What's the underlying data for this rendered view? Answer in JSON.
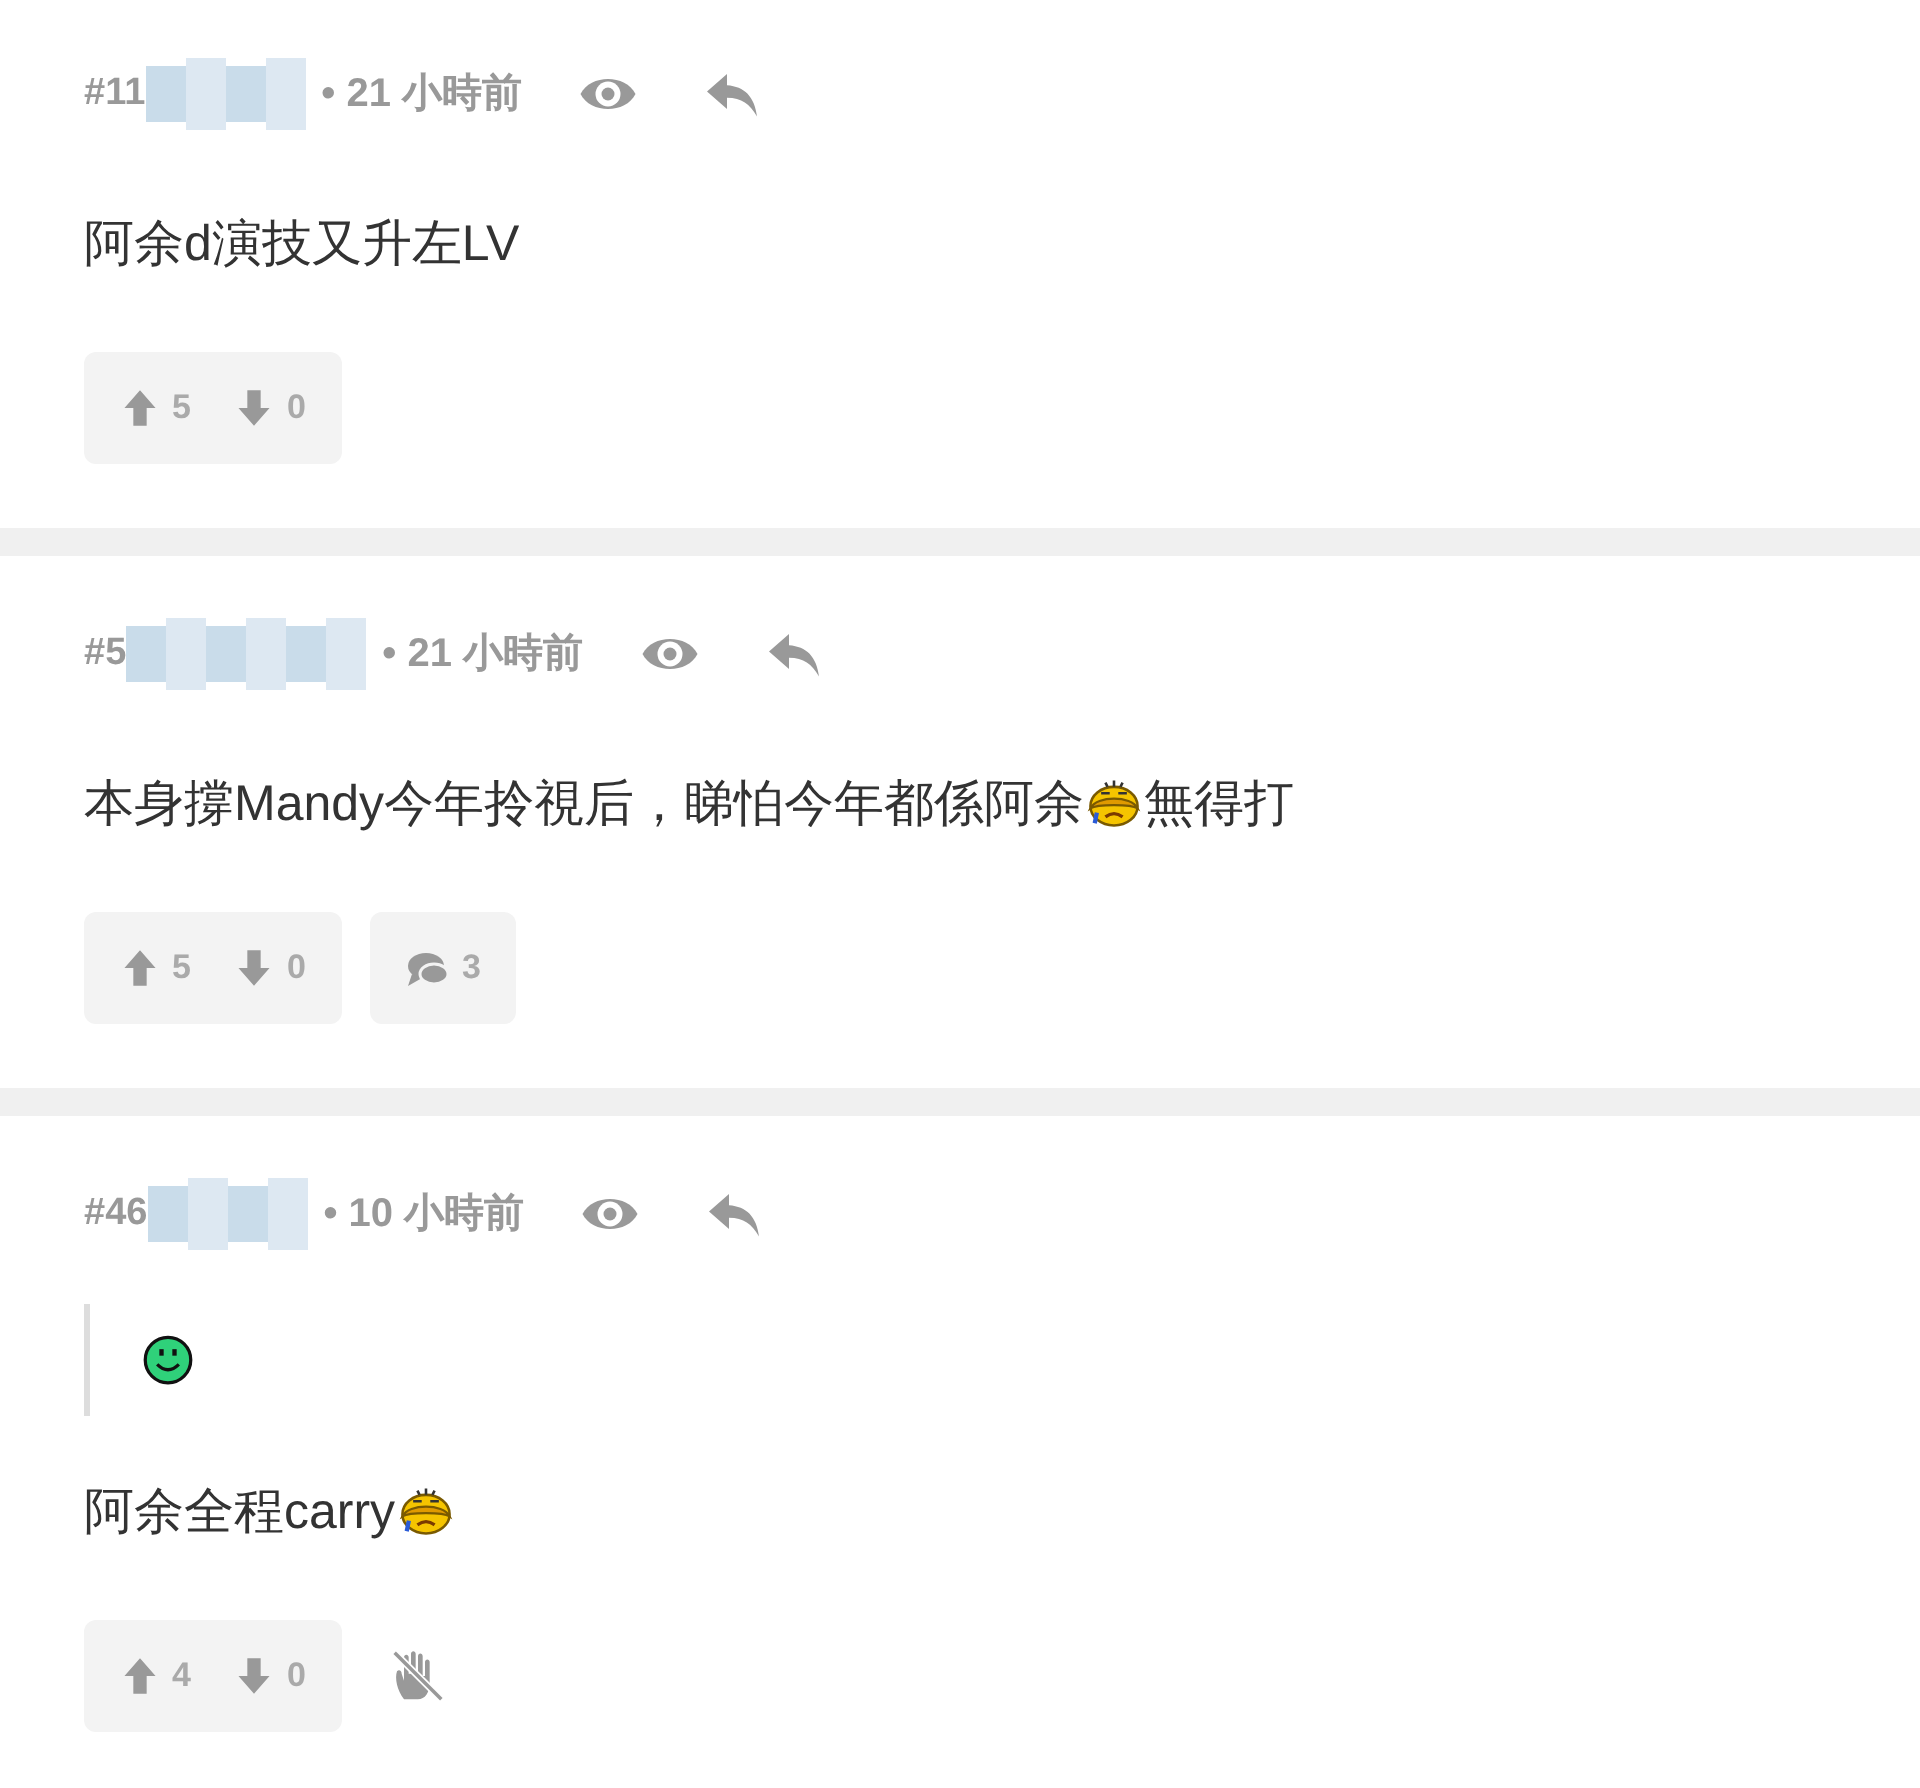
{
  "posts": [
    {
      "floor": "#11",
      "time": "• 21 小時前",
      "body": [
        {
          "kind": "text",
          "text": "阿余d演技又升左LV"
        }
      ],
      "upvotes": "5",
      "downvotes": "0"
    },
    {
      "floor": "#5",
      "time": "• 21 小時前",
      "body": [
        {
          "kind": "text",
          "text": "本身撐Mandy今年拎視后，睇怕今年都係阿余"
        },
        {
          "kind": "crying-face"
        },
        {
          "kind": "text",
          "text": "無得打"
        }
      ],
      "upvotes": "5",
      "downvotes": "0",
      "replies": "3"
    },
    {
      "floor": "#46",
      "time": "• 10 小時前",
      "quote": [
        {
          "kind": "smiley"
        }
      ],
      "body": [
        {
          "kind": "text",
          "text": "阿余全程carry"
        },
        {
          "kind": "crying-face"
        }
      ],
      "upvotes": "4",
      "downvotes": "0",
      "blocked": true
    }
  ]
}
